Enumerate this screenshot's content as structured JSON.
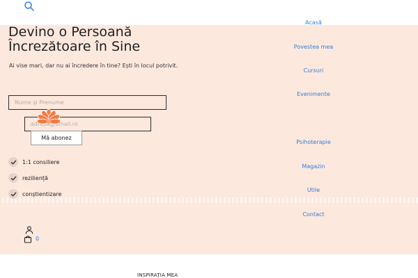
{
  "header": {
    "search_icon": "search-icon"
  },
  "hero": {
    "title_line1": "Devino o Persoană",
    "title_line2": "Încrezătoare în Sine",
    "subtitle": "Ai vise mari, dar nu ai încredere în tine? Ești în locul potrivit.",
    "background_color": "#fde8de"
  },
  "form": {
    "name_placeholder": "Nume și Prenume",
    "email_placeholder": "adresa@email.ro",
    "submit_label": "Mă abonez"
  },
  "features": [
    {
      "label": "1:1 consiliere"
    },
    {
      "label": "reziliență"
    },
    {
      "label": "conștientizare"
    }
  ],
  "nav": {
    "items": [
      {
        "label": "Acasă"
      },
      {
        "label": "Povestea mea"
      },
      {
        "label": "Cursuri"
      },
      {
        "label": "Evenimente"
      },
      {
        "label": "Psihoterapie"
      },
      {
        "label": "Magazin"
      },
      {
        "label": "Utile"
      },
      {
        "label": "Contact"
      }
    ],
    "link_color": "#2f7fd6"
  },
  "account": {
    "cart_count": "0"
  },
  "section": {
    "heading": "INSPIRAȚIA MEA"
  }
}
